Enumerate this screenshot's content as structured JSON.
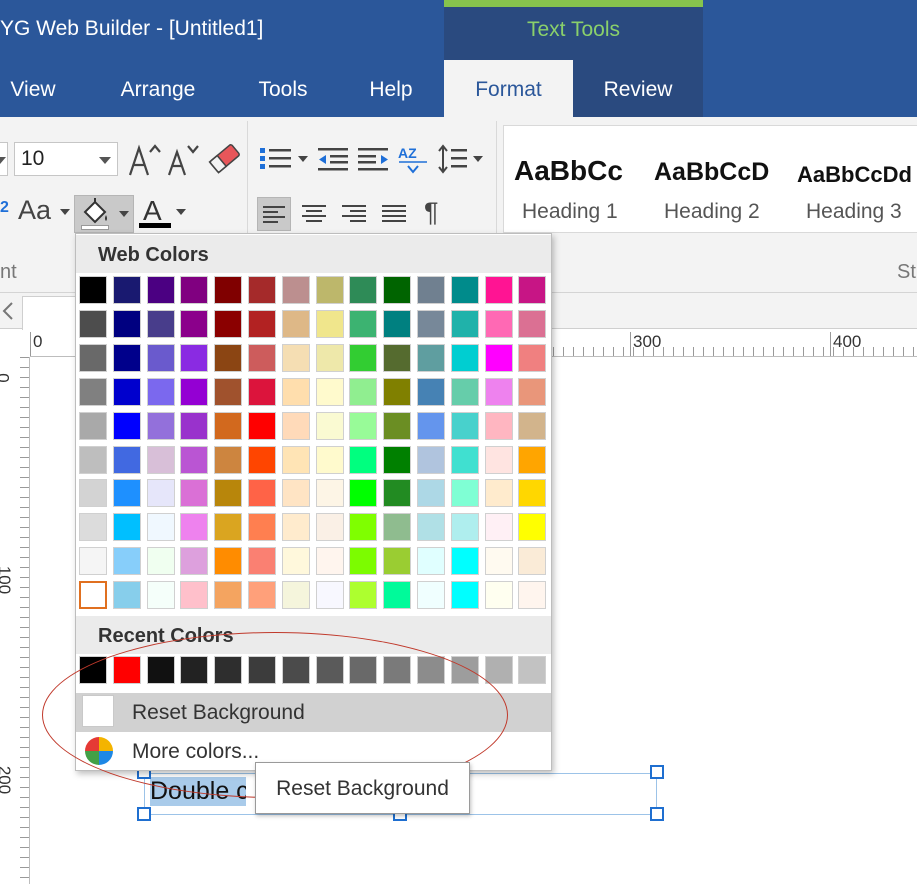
{
  "window": {
    "title": "YG Web Builder - [Untitled1]",
    "context_tab_group": "Text Tools"
  },
  "menu": {
    "tabs": [
      "View",
      "Arrange",
      "Tools",
      "Help",
      "Format",
      "Review"
    ],
    "active": "Format"
  },
  "ribbon": {
    "font_size": "10",
    "change_case_label": "Aa",
    "font_color_letter": "A",
    "group_font_label": "nt",
    "group_styles_label": "St",
    "paragraph_mark": "¶",
    "styles": [
      {
        "sample": "AaBbCc",
        "name": "Heading 1"
      },
      {
        "sample": "AaBbCcD",
        "name": "Heading 2"
      },
      {
        "sample": "AaBbCcDd",
        "name": "Heading 3"
      }
    ]
  },
  "rulers": {
    "horizontal": [
      "0",
      "300",
      "400"
    ],
    "vertical": [
      "0",
      "100",
      "200"
    ]
  },
  "canvas": {
    "textbox_text": "Double click to edit"
  },
  "color_picker": {
    "web_colors_title": "Web Colors",
    "recent_colors_title": "Recent Colors",
    "selected_index": [
      9,
      0
    ],
    "web_colors": [
      [
        "#000000",
        "#191970",
        "#4b0082",
        "#800080",
        "#800000",
        "#a52a2a",
        "#bc8f8f",
        "#bdb76b",
        "#2e8b57",
        "#006400",
        "#708090",
        "#008b8b",
        "#ff1493",
        "#c71585"
      ],
      [
        "#4d4d4d",
        "#000080",
        "#483d8b",
        "#8b008b",
        "#8b0000",
        "#b22222",
        "#deb887",
        "#f0e68c",
        "#3cb371",
        "#008080",
        "#778899",
        "#20b2aa",
        "#ff69b4",
        "#db7093"
      ],
      [
        "#696969",
        "#00008b",
        "#6a5acd",
        "#8a2be2",
        "#8b4513",
        "#cd5c5c",
        "#f5deb3",
        "#eee8aa",
        "#32cd32",
        "#556b2f",
        "#5f9ea0",
        "#00ced1",
        "#ff00ff",
        "#f08080"
      ],
      [
        "#808080",
        "#0000cd",
        "#7b68ee",
        "#9400d3",
        "#a0522d",
        "#dc143c",
        "#ffdead",
        "#fffacd",
        "#90ee90",
        "#808000",
        "#4682b4",
        "#66cdaa",
        "#ee82ee",
        "#e9967a"
      ],
      [
        "#a9a9a9",
        "#0000ff",
        "#9370db",
        "#9932cc",
        "#d2691e",
        "#ff0000",
        "#ffdab9",
        "#fafad2",
        "#98fb98",
        "#6b8e23",
        "#6495ed",
        "#48d1cc",
        "#ffb6c1",
        "#d2b48c"
      ],
      [
        "#bebebe",
        "#4169e1",
        "#d8bfd8",
        "#ba55d3",
        "#cd853f",
        "#ff4500",
        "#ffe4b5",
        "#fffacd",
        "#00ff7f",
        "#008000",
        "#b0c4de",
        "#40e0d0",
        "#ffe4e1",
        "#ffa500"
      ],
      [
        "#d3d3d3",
        "#1e90ff",
        "#e6e6fa",
        "#da70d6",
        "#b8860b",
        "#ff6347",
        "#ffe4c4",
        "#fdf5e6",
        "#00ff00",
        "#228b22",
        "#add8e6",
        "#7fffd4",
        "#ffebcd",
        "#ffd700"
      ],
      [
        "#dcdcdc",
        "#00bfff",
        "#f0f8ff",
        "#ee82ee",
        "#daa520",
        "#ff7f50",
        "#ffebcd",
        "#faf0e6",
        "#7fff00",
        "#8fbc8f",
        "#b0e0e6",
        "#afeeee",
        "#fff0f5",
        "#ffff00"
      ],
      [
        "#f5f5f5",
        "#87cefa",
        "#f0fff0",
        "#dda0dd",
        "#ff8c00",
        "#fa8072",
        "#fff8dc",
        "#fff5ee",
        "#7cfc00",
        "#9acd32",
        "#e0ffff",
        "#00ffff",
        "#fffaf0",
        "#faebd7"
      ],
      [
        "#ffffff",
        "#87ceeb",
        "#f5fffa",
        "#ffc0cb",
        "#f4a460",
        "#ffa07a",
        "#f5f5dc",
        "#f8f8ff",
        "#adff2f",
        "#00fa9a",
        "#f0ffff",
        "#00ffff",
        "#fffff0",
        "#fff5ee"
      ]
    ],
    "recent_colors": [
      "#000000",
      "#ff0000",
      "#111111",
      "#222222",
      "#2e2e2e",
      "#3c3c3c",
      "#4b4b4b",
      "#5a5a5a",
      "#696969",
      "#7a7a7a",
      "#8c8c8c",
      "#9d9d9d",
      "#b0b0b0",
      "#c2c2c2"
    ],
    "reset_label": "Reset Background",
    "more_label": "More colors...",
    "tooltip": "Reset Background"
  }
}
